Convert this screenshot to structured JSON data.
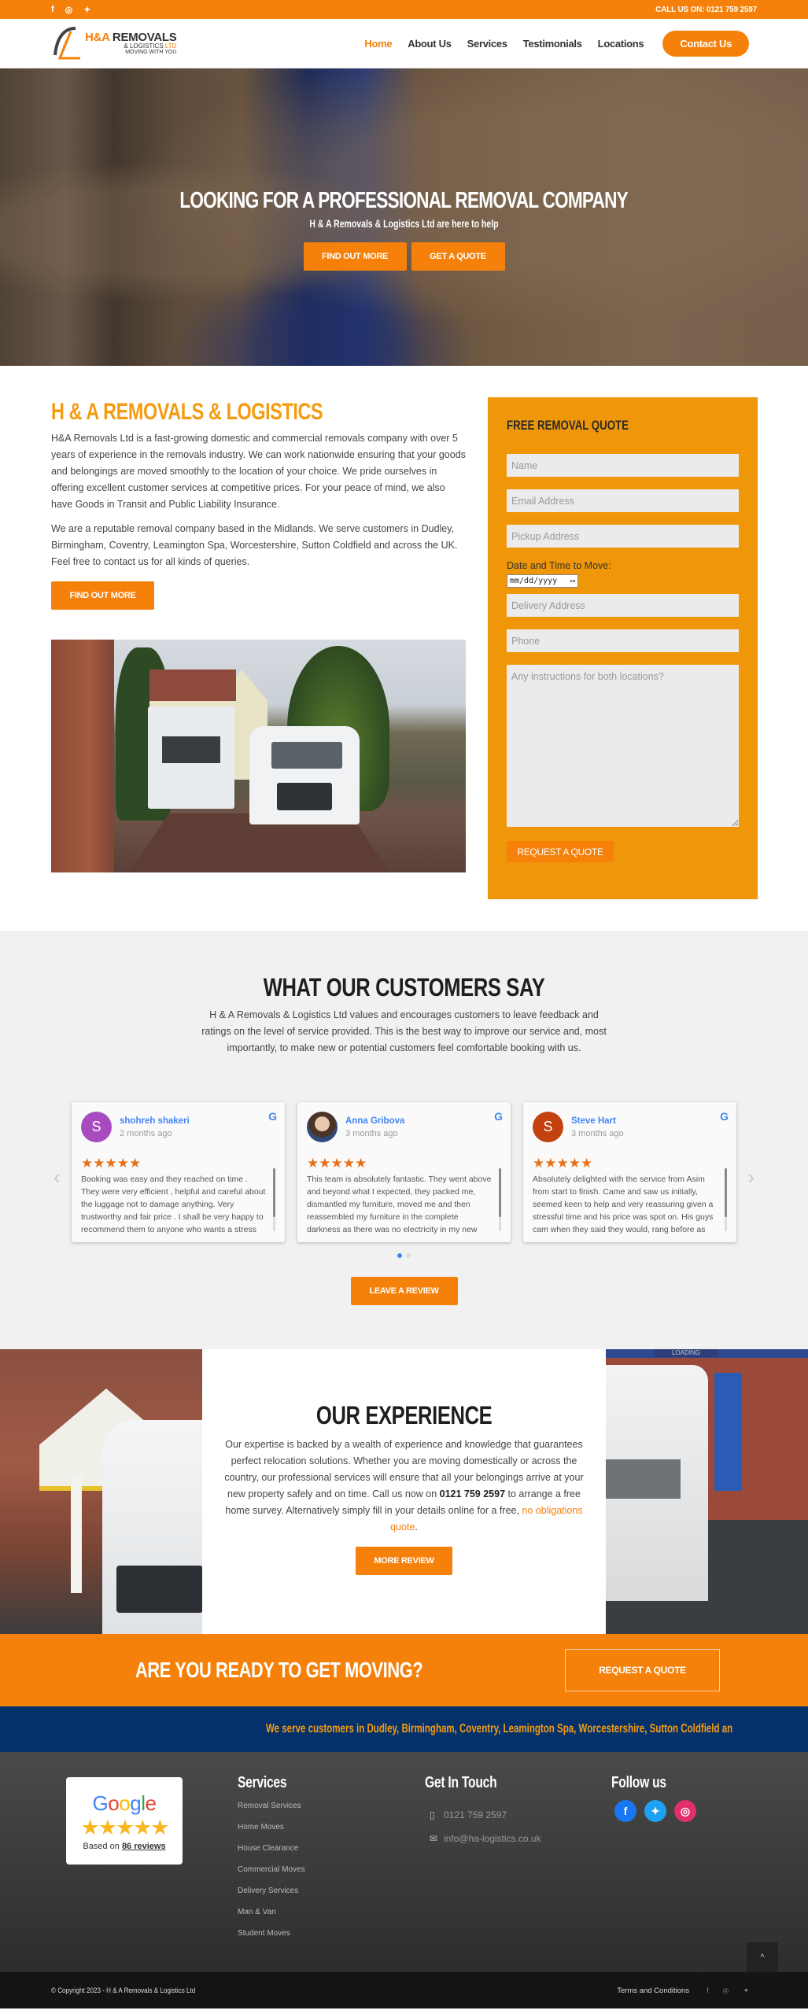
{
  "topbar": {
    "socials": [
      {
        "icon": "facebook-icon",
        "glyph": "f"
      },
      {
        "icon": "instagram-icon",
        "glyph": "◎"
      },
      {
        "icon": "twitter-icon",
        "glyph": "🐦"
      }
    ],
    "call": "CALL US ON: 0121 759 2597"
  },
  "header": {
    "logo": {
      "line1_a": "H&A ",
      "line1_b": "REMOVALS",
      "line2_a": "& LOGISTICS ",
      "line2_b": "LTD",
      "line3": "MOVING WITH YOU"
    },
    "nav": [
      {
        "label": "Home",
        "active": true
      },
      {
        "label": "About Us"
      },
      {
        "label": "Services"
      },
      {
        "label": "Testimonials"
      },
      {
        "label": "Locations"
      }
    ],
    "contact_label": "Contact Us"
  },
  "hero": {
    "title": "LOOKING FOR A PROFESSIONAL REMOVAL COMPANY",
    "subtitle": "H & A Removals & Logistics Ltd are here to help",
    "btn_find": "FIND OUT MORE",
    "btn_quote": "GET A QUOTE"
  },
  "about": {
    "title": "H & A REMOVALS & LOGISTICS",
    "p1": "H&A Removals Ltd is a fast-growing domestic and commercial removals company with over 5 years of experience in the removals industry. We can work nationwide ensuring that your goods and belongings are moved smoothly to the location of your choice. We pride ourselves in offering excellent customer services at competitive prices. For your peace of mind, we also have Goods in Transit and Public Liability Insurance.",
    "p2": "We are a reputable removal company based in the Midlands. We serve customers in Dudley, Birmingham, Coventry, Leamington Spa, Worcestershire, Sutton Coldfield and across the UK. Feel free to contact us for all kinds of queries.",
    "btn": "FIND OUT MORE"
  },
  "quote_form": {
    "title": "FREE REMOVAL QUOTE",
    "name_ph": "Name",
    "email_ph": "Email Address",
    "pickup_ph": "Pickup Address",
    "date_label": "Date and Time to Move:",
    "date_value": "mm/dd/yyyy",
    "delivery_ph": "Delivery Address",
    "phone_ph": "Phone",
    "instructions_ph": "Any instructions for both locations?",
    "submit": "REQUEST A QUOTE"
  },
  "testimonials": {
    "title": "WHAT OUR CUSTOMERS SAY",
    "intro": "H & A Removals & Logistics Ltd values and encourages customers to leave feedback and ratings on the level of service provided. This is the best way to improve our service and, most importantly, to make new or potential customers feel comfortable booking with us.",
    "reviews": [
      {
        "initial": "S",
        "avatar_color": "#a94bc0",
        "name": "shohreh shakeri",
        "time": "2 months ago",
        "rating": 5,
        "text": "Booking was easy and they reached on time . They were very efficient , helpful and careful about the luggage not to damage anything. Very trustworthy and  fair price . I shall  be very happy to recommend them to anyone who wants a stress free move ."
      },
      {
        "initial": "",
        "avatar_color": "",
        "name": "Anna Gribova",
        "time": "3 months ago",
        "rating": 5,
        "text": "This team is absolutely fantastic. They went above and beyond what I expected, they packed me, dismantled my furniture, moved me and then reassembled my furniture in the complete darkness as there was no electricity in my new home. They"
      },
      {
        "initial": "S",
        "avatar_color": "#c2410f",
        "name": "Steve Hart",
        "time": "3 months ago",
        "rating": 5,
        "text": "Absolutely delighted with the service from Asim from start to finish. Came and saw us initially, seemed keen to help and very reassuring given a stressful time and his price was spot on. His guys cam when they said they would, rang before as planned and"
      }
    ],
    "stars": "★★★★★",
    "google_glyph": "G",
    "prev": "‹",
    "next": "›",
    "pages": 2,
    "active_page": 1,
    "btn": "LEAVE A REVIEW"
  },
  "experience": {
    "title": "OUR EXPERIENCE",
    "p_before": "Our expertise is backed by a wealth of experience and knowledge that guarantees perfect relocation solutions. Whether you are moving domestically or across the country, our professional services will ensure that all your belongings arrive at your new property safely and on time. Call us now on ",
    "phone": "0121 759 2597",
    "p_mid": " to arrange a free home survey. Alternatively simply fill in your details online for a free, ",
    "link": "no obligations quote",
    "p_end": ".",
    "btn": "MORE REVIEW",
    "right_img_sign": "LOADING"
  },
  "cta": {
    "title": "ARE YOU READY TO GET MOVING?",
    "btn": "REQUEST A QUOTE"
  },
  "ticker": {
    "text": "We serve customers in Dudley, Birmingham, Coventry, Leamington Spa, Worcestershire, Sutton Coldfield an"
  },
  "footer": {
    "google_badge": {
      "logo": "Google",
      "stars": "★★★★★",
      "based_on": "Based on ",
      "reviews": "86 reviews"
    },
    "services": {
      "title": "Services",
      "items": [
        "Removal Services",
        "Home Moves",
        "House Clearance",
        "Commercial Moves",
        "Delivery Services",
        "Man & Van",
        "Student Moves"
      ]
    },
    "touch": {
      "title": "Get In Touch",
      "phone": "0121 759 2597",
      "email": "info@ha-logistics.co.uk"
    },
    "follow": {
      "title": "Follow us"
    },
    "to_top": "^"
  },
  "bottom": {
    "copyright": "© Copyright 2023 - H & A Removals & Logistics Ltd",
    "terms": "Terms and Conditions"
  },
  "colors": {
    "brand_orange": "#f5810b",
    "form_orange": "#ef9708",
    "navy": "#05316b",
    "google_blue": "#4285f4",
    "star_orange": "#e7711b"
  }
}
